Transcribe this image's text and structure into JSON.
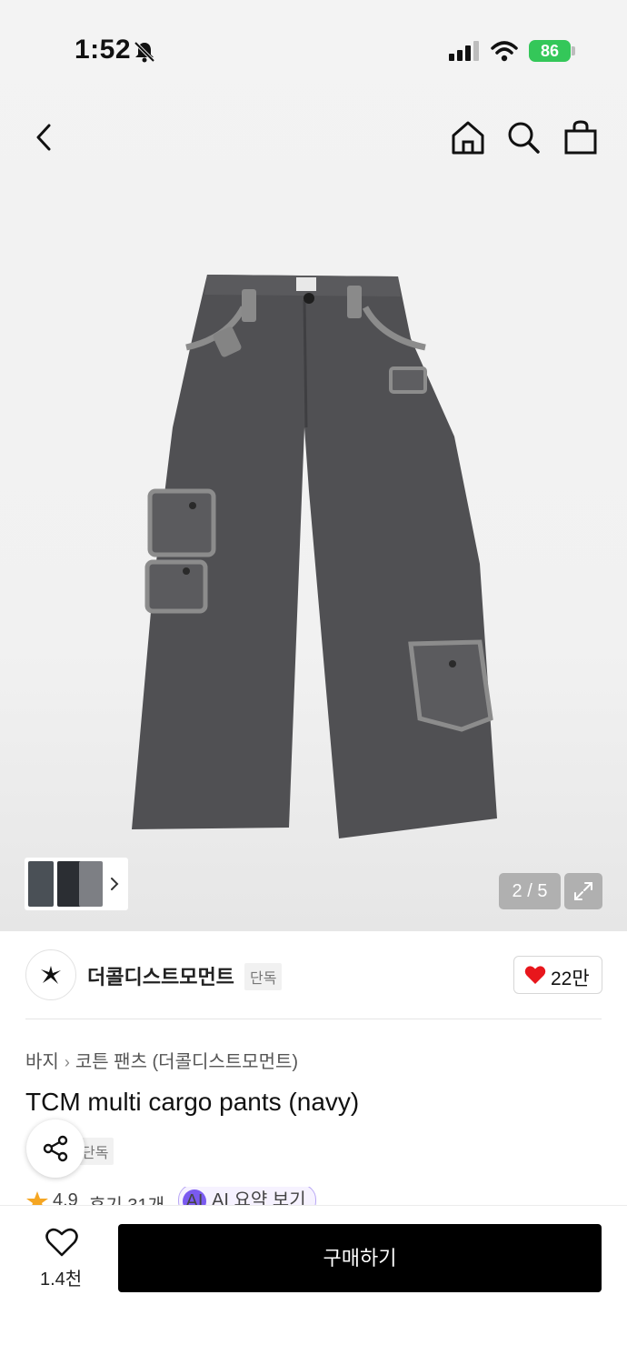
{
  "status_bar": {
    "time": "1:52",
    "battery": "86"
  },
  "gallery": {
    "counter": "2 / 5"
  },
  "brand": {
    "name": "더콜디스트모먼트",
    "tag": "단독",
    "likes": "22만"
  },
  "breadcrumb": {
    "category": "바지",
    "subcategory": "코튼 팬츠 (더콜디스트모먼트)"
  },
  "product": {
    "title": "TCM multi cargo pants (navy)",
    "exclusive_tag": "단독"
  },
  "rating": {
    "score": "4.9",
    "reviews": "후기 31개",
    "ai_badge": "AI",
    "ai_summary": "AI 요약 보기"
  },
  "bottom_bar": {
    "wish_count": "1.4천",
    "buy_label": "구매하기"
  },
  "colors": {
    "accent": "#000000",
    "heart": "#e8161c",
    "battery": "#34c759",
    "ai": "#7a5af0"
  },
  "icons": [
    "back-icon",
    "home-icon",
    "search-icon",
    "bag-icon",
    "chevron-right-icon",
    "expand-icon",
    "heart-icon",
    "share-icon",
    "star-icon"
  ]
}
